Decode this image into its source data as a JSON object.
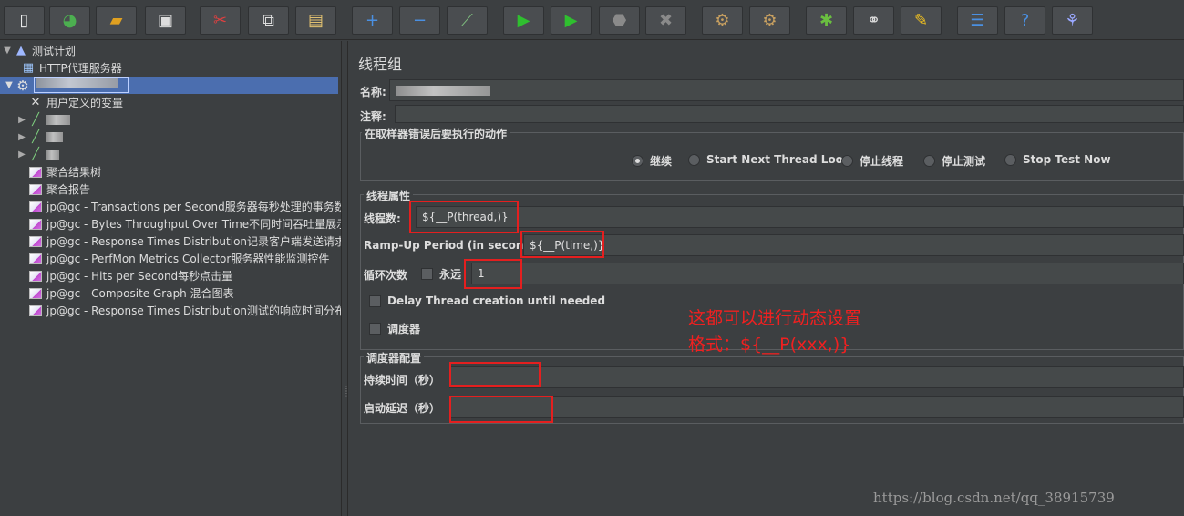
{
  "toolbar": {
    "buttons": [
      {
        "name": "new-icon",
        "glyph": "▯",
        "color": "#f0f0f0"
      },
      {
        "name": "templates-icon",
        "glyph": "◕",
        "color": "#4caf50"
      },
      {
        "name": "open-icon",
        "glyph": "▰",
        "color": "#e0a020"
      },
      {
        "name": "save-icon",
        "glyph": "▣",
        "color": "#dddddd"
      },
      {
        "name": "cut-icon",
        "glyph": "✂",
        "color": "#e04040"
      },
      {
        "name": "copy-icon",
        "glyph": "⧉",
        "color": "#dddddd"
      },
      {
        "name": "paste-icon",
        "glyph": "▤",
        "color": "#e0c070"
      },
      {
        "name": "expand-icon",
        "glyph": "+",
        "color": "#4a90e2"
      },
      {
        "name": "collapse-icon",
        "glyph": "−",
        "color": "#4a90e2"
      },
      {
        "name": "toggle-icon",
        "glyph": "⟋",
        "color": "#7fbf7f"
      },
      {
        "name": "start-icon",
        "glyph": "▶",
        "color": "#2fbf2f"
      },
      {
        "name": "start-no-pauses-icon",
        "glyph": "▶",
        "color": "#2fbf2f"
      },
      {
        "name": "stop-icon",
        "glyph": "⬣",
        "color": "#8a8a8a"
      },
      {
        "name": "shutdown-icon",
        "glyph": "✖",
        "color": "#8a8a8a"
      },
      {
        "name": "clear-icon",
        "glyph": "⚙",
        "color": "#c8a060"
      },
      {
        "name": "clear-all-icon",
        "glyph": "⚙",
        "color": "#c8a060"
      },
      {
        "name": "search-icon",
        "glyph": "✱",
        "color": "#6abf40"
      },
      {
        "name": "binoculars-icon",
        "glyph": "⚭",
        "color": "#dddddd"
      },
      {
        "name": "reset-search-icon",
        "glyph": "✎",
        "color": "#f0c020"
      },
      {
        "name": "function-helper-icon",
        "glyph": "☰",
        "color": "#4a90e2"
      },
      {
        "name": "help-icon",
        "glyph": "?",
        "color": "#4a90e2"
      },
      {
        "name": "remote-icon",
        "glyph": "⚘",
        "color": "#9aa8ff"
      }
    ]
  },
  "tree": {
    "root_label": "测试计划",
    "items": [
      {
        "label": "HTTP代理服务器"
      },
      {
        "label": "线程组"
      },
      {
        "label": "用户定义的变量"
      },
      {
        "label": "聚合结果树"
      },
      {
        "label": "聚合报告"
      },
      {
        "label": "jp@gc - Transactions per Second服务器每秒处理的事务数"
      },
      {
        "label": "jp@gc - Bytes Throughput Over Time不同时间吞吐量展示"
      },
      {
        "label": "jp@gc - Response Times Distribution记录客户端发送请求"
      },
      {
        "label": "jp@gc - PerfMon Metrics Collector服务器性能监测控件"
      },
      {
        "label": "jp@gc - Hits per Second每秒点击量"
      },
      {
        "label": "jp@gc - Composite Graph 混合图表"
      },
      {
        "label": "jp@gc - Response Times Distribution测试的响应时间分布"
      }
    ]
  },
  "panel": {
    "title": "线程组",
    "name_label": "名称:",
    "comment_label": "注释:",
    "on_error": {
      "title": "在取样器错误后要执行的动作",
      "options": [
        "继续",
        "Start Next Thread Loop",
        "停止线程",
        "停止测试",
        "Stop Test Now"
      ],
      "selected": "继续"
    },
    "thread_props": {
      "title": "线程属性",
      "threads_label": "线程数:",
      "threads_value": "${__P(thread,)}",
      "rampup_label": "Ramp-Up Period (in seconds):",
      "rampup_value": "${__P(time,)}",
      "loop_label": "循环次数",
      "forever_label": "永远",
      "loop_value": "1",
      "delay_label": "Delay Thread creation until needed",
      "scheduler_label": "调度器"
    },
    "scheduler": {
      "title": "调度器配置",
      "duration_label": "持续时间（秒）",
      "duration_value": "",
      "delay_label": "启动延迟（秒）",
      "delay_value": ""
    }
  },
  "annotation": {
    "line1": "这都可以进行动态设置",
    "line2": "格式：${__P(xxx,)}",
    "color": "#f02020"
  },
  "watermark": "https://blog.csdn.net/qq_38915739"
}
